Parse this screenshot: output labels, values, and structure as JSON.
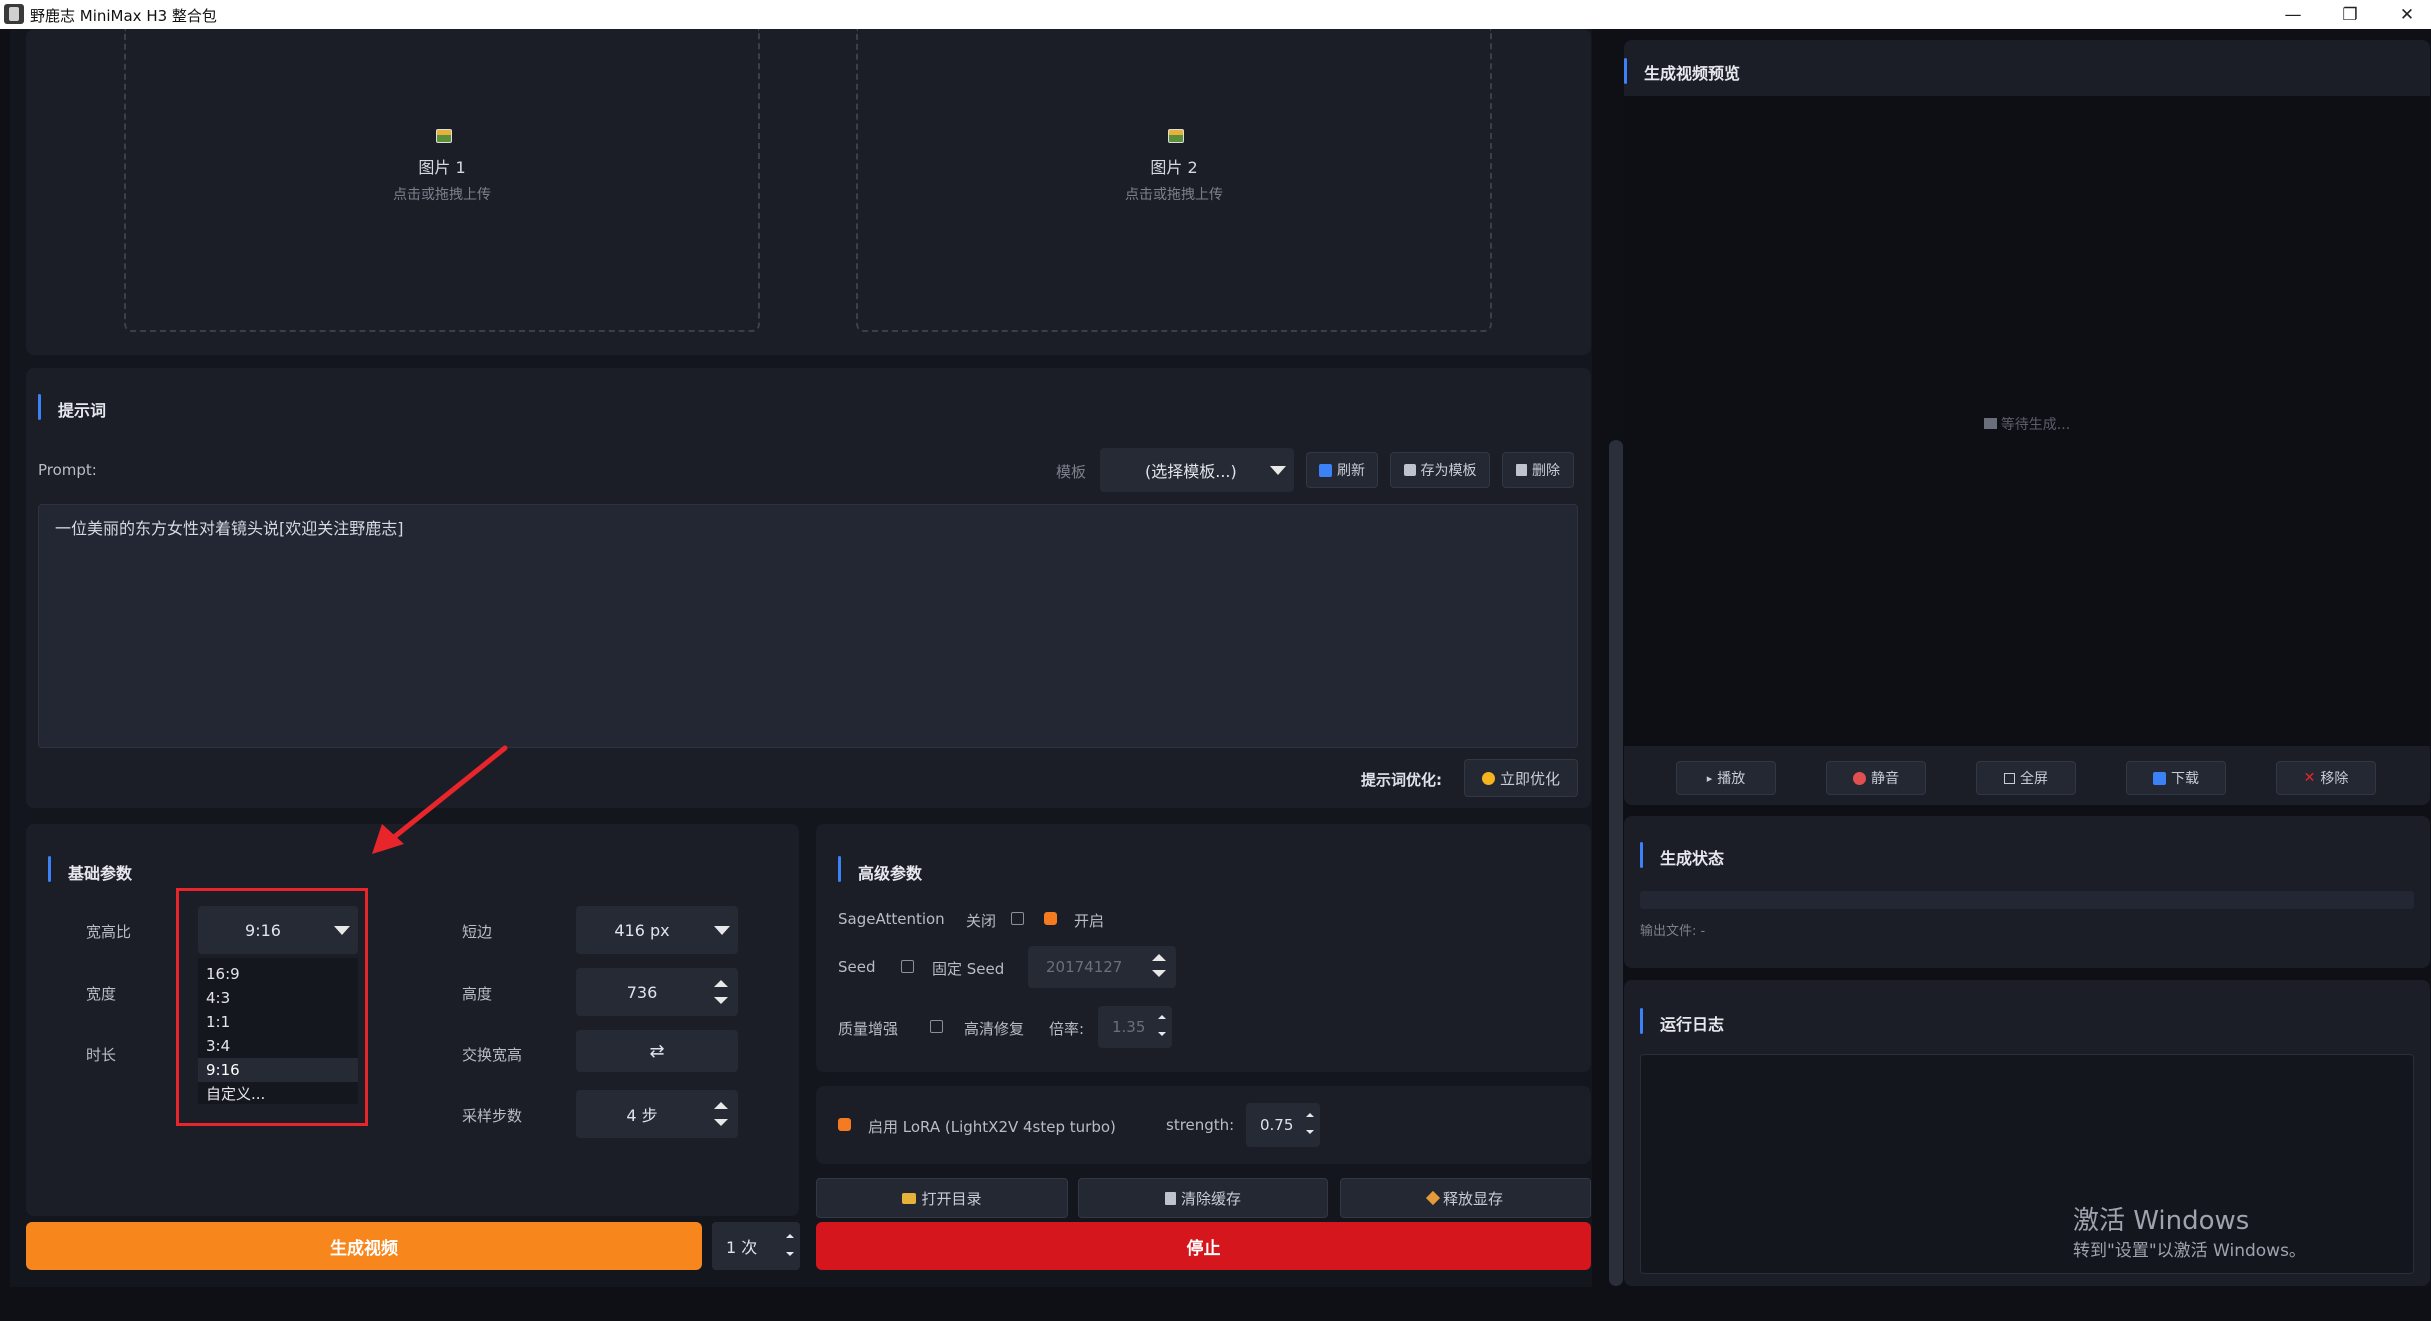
{
  "window": {
    "title": "野鹿志 MiniMax H3 整合包"
  },
  "upload": {
    "slots": [
      {
        "label": "图片 1",
        "hint": "点击或拖拽上传"
      },
      {
        "label": "图片 2",
        "hint": "点击或拖拽上传"
      }
    ]
  },
  "prompt": {
    "section_title": "提示词",
    "label": "Prompt:",
    "template_label": "模板",
    "template_value": "(选择模板...)",
    "refresh_label": "刷新",
    "save_template_label": "存为模板",
    "delete_label": "删除",
    "text": "一位美丽的东方女性对着镜头说[欢迎关注野鹿志]",
    "optimize_label": "提示词优化:",
    "optimize_button": "立即优化"
  },
  "basic": {
    "section_title": "基础参数",
    "ratio_label": "宽高比",
    "ratio_value": "9:16",
    "ratio_options": [
      "16:9",
      "4:3",
      "1:1",
      "3:4",
      "9:16",
      "自定义..."
    ],
    "ratio_selected": "9:16",
    "width_label": "宽度",
    "duration_label": "时长",
    "short_side_label": "短边",
    "short_side_value": "416 px",
    "height_label": "高度",
    "height_value": "736",
    "swap_label": "交换宽高",
    "swap_symbol": "⇄",
    "steps_label": "采样步数",
    "steps_value": "4 步"
  },
  "advanced": {
    "section_title": "高级参数",
    "sage_label": "SageAttention",
    "sage_off": "关闭",
    "sage_on": "开启",
    "seed_label": "Seed",
    "fixed_seed_label": "固定 Seed",
    "seed_value": "20174127",
    "quality_label": "质量增强",
    "hd_fix_label": "高清修复",
    "scale_label": "倍率:",
    "scale_value": "1.35",
    "lora_label": "启用 LoRA (LightX2V 4step turbo)",
    "strength_label": "strength:",
    "strength_value": "0.75"
  },
  "utility": {
    "open_dir": "打开目录",
    "clear_cache": "清除缓存",
    "free_vram": "释放显存"
  },
  "actions": {
    "generate": "生成视频",
    "count": "1 次",
    "stop": "停止"
  },
  "preview": {
    "section_title": "生成视频预览",
    "waiting": "等待生成...",
    "play": "播放",
    "mute": "静音",
    "fullscreen": "全屏",
    "download": "下载",
    "remove": "移除"
  },
  "status": {
    "section_title": "生成状态",
    "output_file": "输出文件: -"
  },
  "log": {
    "section_title": "运行日志"
  },
  "watermark": {
    "line1": "激活 Windows",
    "line2": "转到\"设置\"以激活 Windows。"
  },
  "colors": {
    "accent": "#3b82f6",
    "generate": "#f7861d",
    "stop": "#d5161c",
    "highlight_box": "#e8252b",
    "checkbox_on": "#f47b20"
  }
}
